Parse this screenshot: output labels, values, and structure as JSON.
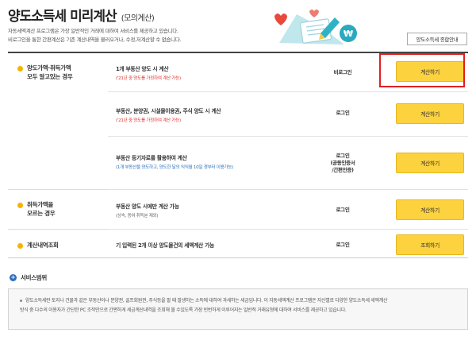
{
  "header": {
    "title": "양도소득세 미리계산",
    "subtitle": "(모의계산)",
    "intro_line1": "자동세액계산 프로그램은 가장 일반적인 거래에 대하여 서비스를 제공하고 있습니다.",
    "intro_line2": "비로그인을 통한 간편계산은 기존 계산내역을 불러오거나, 수정,저계산할 수 없습니다.",
    "overview_button": "양도소득세 종합안내"
  },
  "groups": [
    {
      "label": "양도가액·취득가액\n모두 알고있는 경우"
    },
    {
      "label": "취득가액을\n모르는 경우"
    },
    {
      "label": "계산내역조회"
    }
  ],
  "rows": [
    {
      "description": "1개 부동산 양도 시 계산",
      "note": "('21년 중 양도를 가정하여 계산 가능)",
      "login": "비로그인",
      "button": "계산하기"
    },
    {
      "description": "부동산, 분양권, 시설물이용권, 주식 양도 시 계산",
      "note": "('21년 중 양도를 가정하여 계산 가능)",
      "login": "로그인",
      "button": "계산하기"
    },
    {
      "description": "부동산 등기자료를 활용하여 계산",
      "note": "(1개 부동산을 양도하고, 양도한 달의 익익월 10일 경부터 이용가능)",
      "login": "로그인\n(공동인증서\n/간편인증)",
      "button": "계산하기"
    },
    {
      "description": "부동산 양도 시에만 계산 가능",
      "note": "(상속, 증여 취득분 제외)",
      "login": "로그인",
      "button": "계산하기"
    },
    {
      "description": "기 입력된 2개 이상 양도물건의 세액계산 가능",
      "note": "",
      "login": "로그인",
      "button": "조회하기"
    }
  ],
  "scope": {
    "title": "서비스범위",
    "line1": "양도소득세란 토지나 건물과 같은 부동산이나 분양권, 골프회원권, 주식등을 팔 때 발생하는 소득에 대하여 과세하는 세금입니다. 이 자동세액계산 프로그램은 자신별로 다양한 양도소득세 세액계산",
    "line2": "방식 중 다수의 이용자가 간단한 PC 조작만으로 간편하게 세금계산내역을 조회해 볼 수있도록 가장 빈번하게 이루어지는 일반적 거래유형에 대하여 서비스를 제공하고 있습니다."
  },
  "colors": {
    "accent_yellow": "#fdd23f",
    "bullet_yellow": "#f5b400",
    "note_red": "#e0302c",
    "note_blue": "#2c6fb8",
    "highlight_red": "#e02020",
    "scope_blue": "#2f6fc0"
  }
}
